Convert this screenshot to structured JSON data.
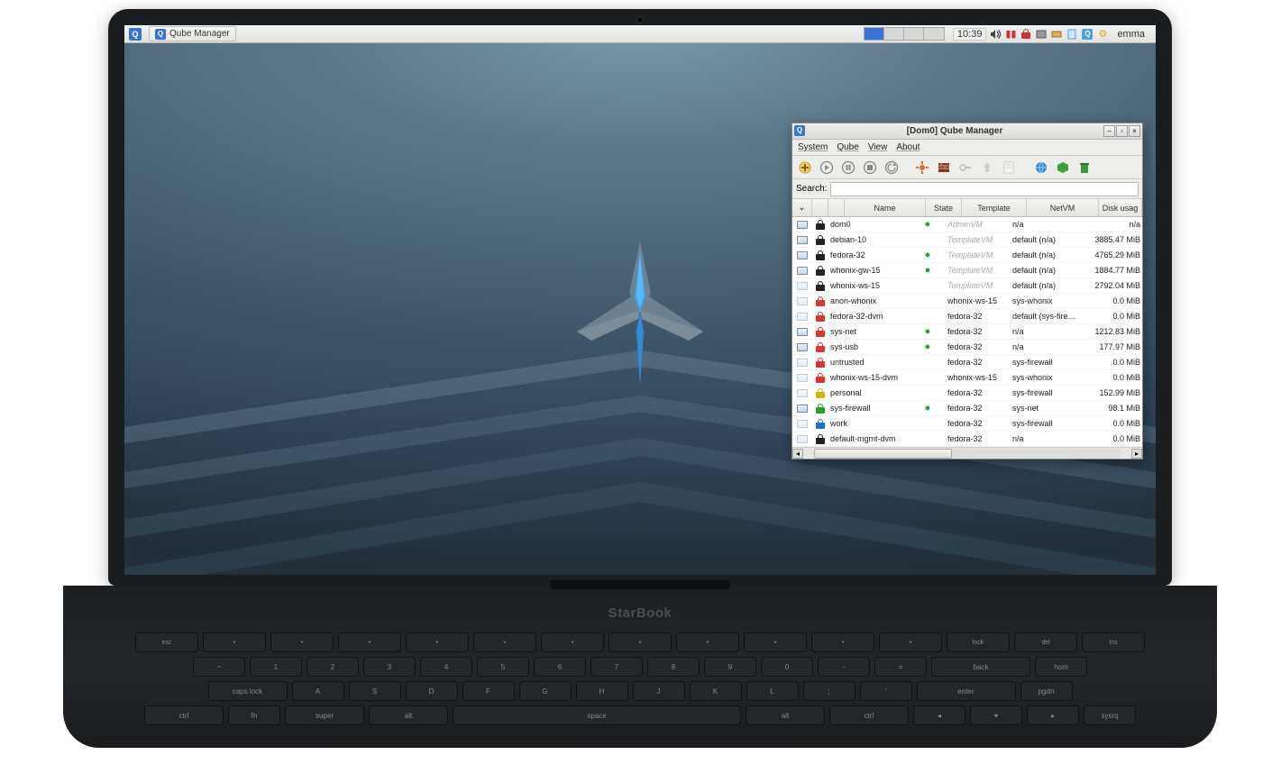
{
  "laptop_brand": "StarBook",
  "panel": {
    "taskbar_app": "Qube Manager",
    "clock": "10:39",
    "user": "emma"
  },
  "qm": {
    "title": "[Dom0] Qube Manager",
    "menus": [
      "System",
      "Qube",
      "View",
      "About"
    ],
    "search_label": "Search:",
    "search_value": "",
    "columns": {
      "chevron": "⌄",
      "name": "Name",
      "state": "State",
      "template": "Template",
      "netvm": "NetVM",
      "disk": "Disk usag"
    },
    "rows": [
      {
        "icon": "mon",
        "lock_color": "#222",
        "name": "dom0",
        "state": "●",
        "template": "AdminVM",
        "template_grey": true,
        "netvm": "n/a",
        "disk": "n/a"
      },
      {
        "icon": "mon",
        "lock_color": "#222",
        "name": "debian-10",
        "state": "",
        "template": "TemplateVM",
        "template_grey": true,
        "netvm": "default (n/a)",
        "disk": "3885.47 MiB"
      },
      {
        "icon": "mon",
        "lock_color": "#222",
        "name": "fedora-32",
        "state": "●",
        "template": "TemplateVM",
        "template_grey": true,
        "netvm": "default (n/a)",
        "disk": "4765.29 MiB"
      },
      {
        "icon": "mon",
        "lock_color": "#222",
        "name": "whonix-gw-15",
        "state": "●",
        "template": "TemplateVM",
        "template_grey": true,
        "netvm": "default (n/a)",
        "disk": "1884.77 MiB"
      },
      {
        "icon": "mon-dim",
        "lock_color": "#222",
        "name": "whonix-ws-15",
        "state": "",
        "template": "TemplateVM",
        "template_grey": true,
        "netvm": "default (n/a)",
        "disk": "2792.04 MiB"
      },
      {
        "icon": "mon-dim",
        "lock_color": "#d33",
        "name": "anon-whonix",
        "state": "",
        "template": "whonix-ws-15",
        "template_grey": false,
        "netvm": "sys-whonix",
        "disk": "0.0 MiB"
      },
      {
        "icon": "mon-dim",
        "lock_color": "#d33",
        "name": "fedora-32-dvm",
        "state": "",
        "template": "fedora-32",
        "template_grey": false,
        "netvm": "default (sys-firewall)",
        "disk": "0.0 MiB"
      },
      {
        "icon": "mon",
        "lock_color": "#d33",
        "name": "sys-net",
        "state": "●",
        "template": "fedora-32",
        "template_grey": false,
        "netvm": "n/a",
        "disk": "1212.83 MiB"
      },
      {
        "icon": "mon",
        "lock_color": "#d33",
        "name": "sys-usb",
        "state": "●",
        "template": "fedora-32",
        "template_grey": false,
        "netvm": "n/a",
        "disk": "177.97 MiB"
      },
      {
        "icon": "mon-dim",
        "lock_color": "#d33",
        "name": "untrusted",
        "state": "",
        "template": "fedora-32",
        "template_grey": false,
        "netvm": "sys-firewall",
        "disk": "0.0 MiB"
      },
      {
        "icon": "mon-dim",
        "lock_color": "#d33",
        "name": "whonix-ws-15-dvm",
        "state": "",
        "template": "whonix-ws-15",
        "template_grey": false,
        "netvm": "sys-whonix",
        "disk": "0.0 MiB"
      },
      {
        "icon": "mon-dim",
        "lock_color": "#d6b400",
        "name": "personal",
        "state": "",
        "template": "fedora-32",
        "template_grey": false,
        "netvm": "sys-firewall",
        "disk": "152.99 MiB"
      },
      {
        "icon": "mon",
        "lock_color": "#2a9d2a",
        "name": "sys-firewall",
        "state": "●",
        "template": "fedora-32",
        "template_grey": false,
        "netvm": "sys-net",
        "disk": "98.1 MiB"
      },
      {
        "icon": "mon-dim",
        "lock_color": "#1a6fd6",
        "name": "work",
        "state": "",
        "template": "fedora-32",
        "template_grey": false,
        "netvm": "sys-firewall",
        "disk": "0.0 MiB"
      },
      {
        "icon": "mon-dim",
        "lock_color": "#222",
        "name": "default-mgmt-dvm",
        "state": "",
        "template": "fedora-32",
        "template_grey": false,
        "netvm": "n/a",
        "disk": "0.0 MiB"
      }
    ]
  }
}
